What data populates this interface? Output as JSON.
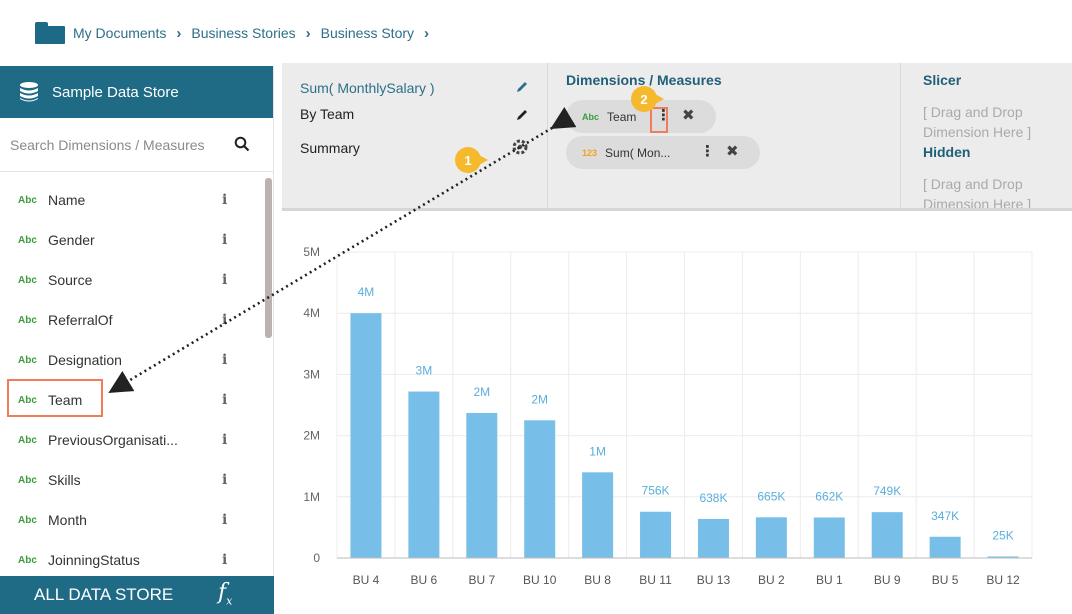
{
  "breadcrumb": [
    "My Documents",
    "Business Stories",
    "Business Story"
  ],
  "left_panel": {
    "title": "Sample Data Store",
    "search_placeholder": "Search Dimensions / Measures",
    "type_label": "Abc",
    "fields": [
      "Name",
      "Gender",
      "Source",
      "ReferralOf",
      "Designation",
      "Team",
      "PreviousOrganisati...",
      "Skills",
      "Month",
      "JoinningStatus"
    ],
    "highlighted_field": "Team",
    "footer_label": "ALL DATA STORE",
    "footer_icon": "fx-icon"
  },
  "config": {
    "metric": "Sum( MonthlySalary )",
    "by": "By Team",
    "summary": "Summary",
    "dimensions_title": "Dimensions / Measures",
    "chips": [
      {
        "type": "Abc",
        "label": "Team"
      },
      {
        "type": "123",
        "label": "Sum( Mon..."
      }
    ],
    "slicer_title": "Slicer",
    "slicer_hint": "[ Drag and Drop Dimension Here ]",
    "hidden_title": "Hidden",
    "hidden_hint": "[ Drag and Drop Dimension Here ]"
  },
  "steps": [
    "1",
    "2"
  ],
  "colors": {
    "accent": "#1f6a85",
    "bar": "#77bfe8",
    "highlight": "#f07c5a",
    "badge": "#f5b92e",
    "abc": "#3d9b3d",
    "num": "#f0a21e"
  },
  "chart_data": {
    "type": "bar",
    "categories": [
      "BU 4",
      "BU 6",
      "BU 7",
      "BU 10",
      "BU 8",
      "BU 11",
      "BU 13",
      "BU 2",
      "BU 1",
      "BU 9",
      "BU 5",
      "BU 12"
    ],
    "values": [
      4000000,
      2720000,
      2370000,
      2250000,
      1400000,
      756000,
      638000,
      665000,
      662000,
      749000,
      347000,
      25000
    ],
    "data_labels": [
      "4M",
      "3M",
      "2M",
      "2M",
      "1M",
      "756K",
      "638K",
      "665K",
      "662K",
      "749K",
      "347K",
      "25K"
    ],
    "y_ticks": [
      0,
      1000000,
      2000000,
      3000000,
      4000000,
      5000000
    ],
    "y_tick_labels": [
      "0",
      "1M",
      "2M",
      "3M",
      "4M",
      "5M"
    ],
    "ylim": [
      0,
      5000000
    ],
    "grid": true
  }
}
